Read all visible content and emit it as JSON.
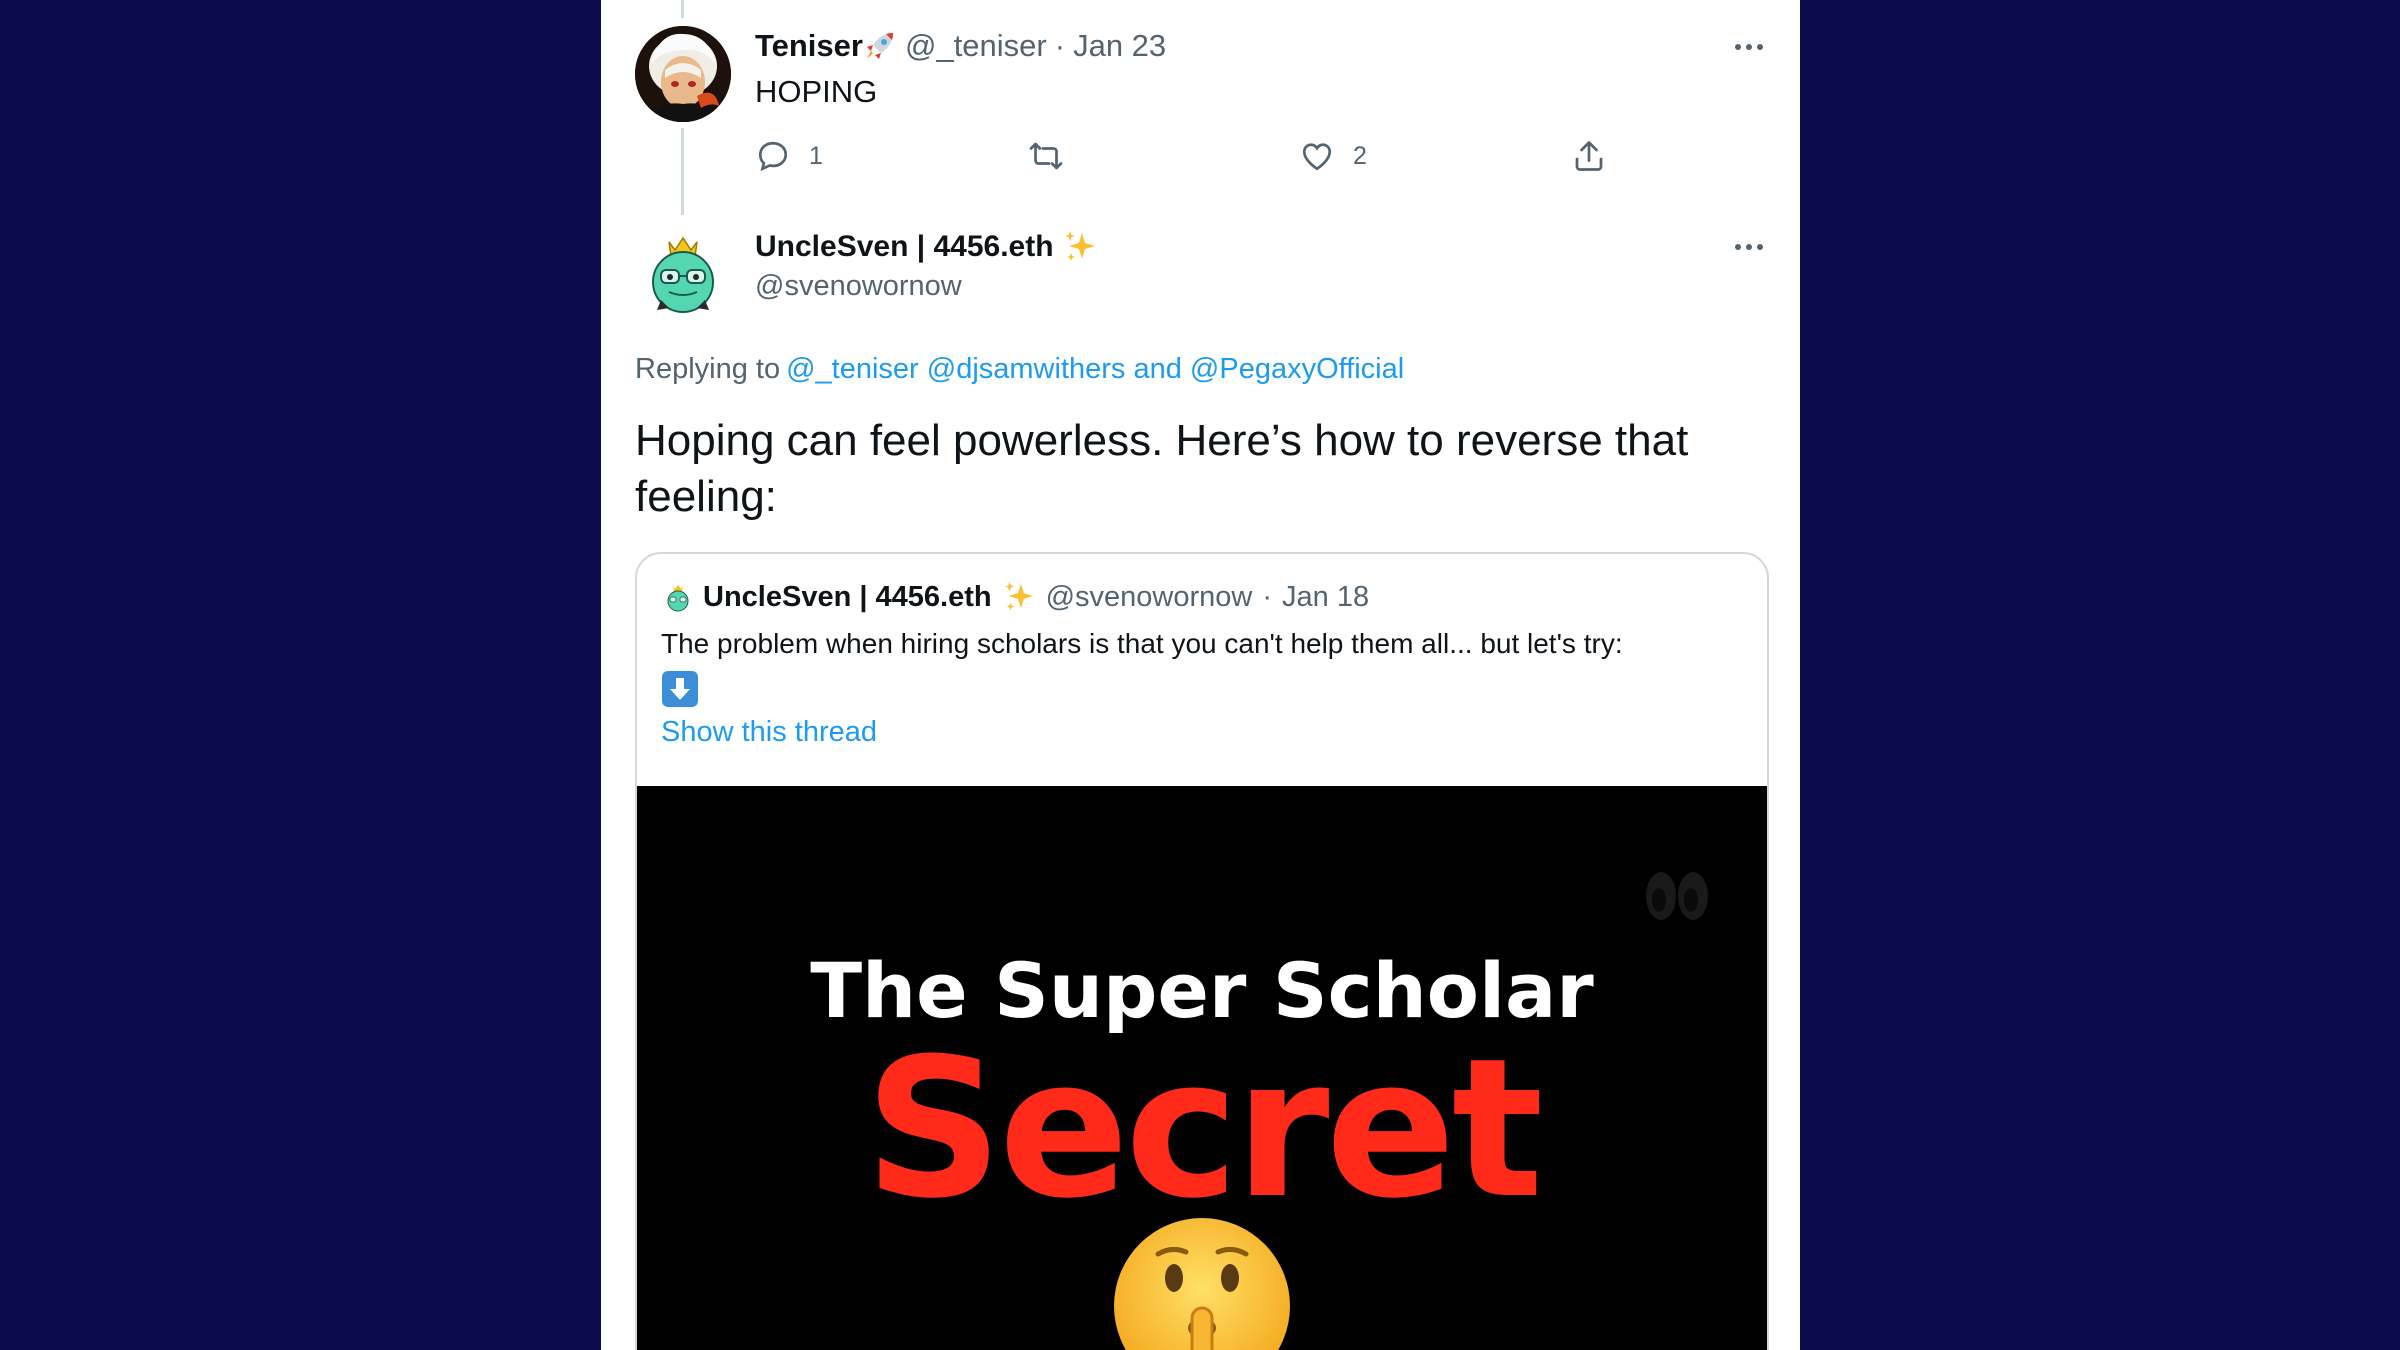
{
  "tweet1": {
    "display_name": "Teniser",
    "handle": "@_teniser",
    "separator": "·",
    "date": "Jan 23",
    "text": "HOPING",
    "reply_count": "1",
    "retweet_count": "",
    "like_count": "2"
  },
  "tweet2": {
    "display_name": "UncleSven | 4456.eth",
    "handle": "@svenowornow",
    "replying_prefix": "Replying to",
    "replying_to": "@_teniser @djsamwithers and @PegaxyOfficial",
    "text": "Hoping can feel powerless. Here’s how to reverse that feeling:"
  },
  "quote": {
    "display_name": "UncleSven | 4456.eth",
    "handle": "@svenowornow",
    "separator": "·",
    "date": "Jan 18",
    "text": "The problem when hiring scholars is that you can't help them all... but let's try:",
    "show_thread": "Show this thread",
    "media": {
      "title": "The Super Scholar",
      "subtitle": "Secret"
    }
  },
  "icons": [
    "rocket-emoji",
    "sparkles-emoji",
    "down-arrow-emoji",
    "reply-icon",
    "retweet-icon",
    "like-icon",
    "share-icon",
    "more-icon",
    "eyes-emoji",
    "shushing-face-emoji"
  ],
  "colors": {
    "background": "#0b0a4a",
    "link": "#1d9bf0",
    "secret_red": "#ff2a1a"
  }
}
